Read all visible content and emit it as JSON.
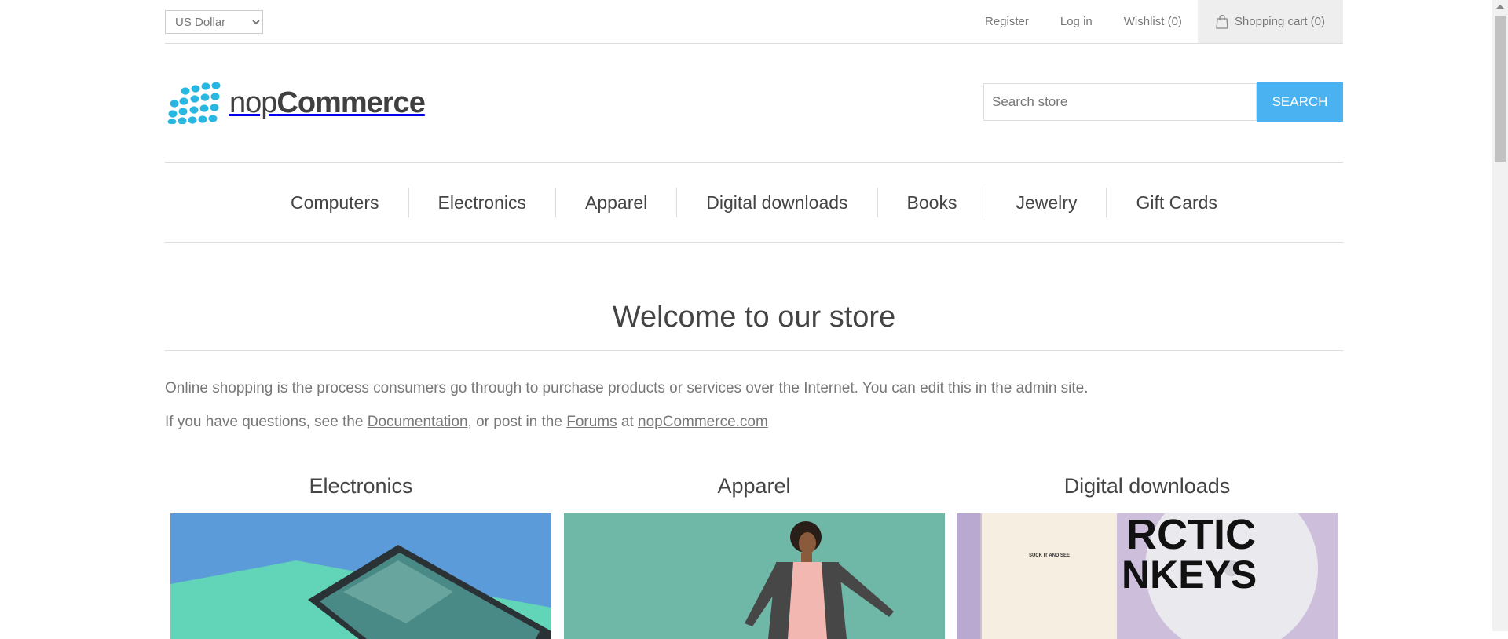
{
  "header": {
    "currency": "US Dollar",
    "links": {
      "register": "Register",
      "login": "Log in",
      "wishlist": "Wishlist (0)",
      "cart": "Shopping cart (0)"
    }
  },
  "logo": {
    "light": "nop",
    "bold": "Commerce"
  },
  "search": {
    "placeholder": "Search store",
    "button": "SEARCH"
  },
  "menu": [
    "Computers",
    "Electronics",
    "Apparel",
    "Digital downloads",
    "Books",
    "Jewelry",
    "Gift Cards"
  ],
  "main": {
    "title": "Welcome to our store",
    "paragraph1": "Online shopping is the process consumers go through to purchase products or services over the Internet. You can edit this in the admin site.",
    "p2_prefix": "If you have questions, see the ",
    "p2_doc": "Documentation",
    "p2_mid": ", or post in the ",
    "p2_forums": "Forums",
    "p2_at": " at ",
    "p2_site": "nopCommerce.com"
  },
  "categories": [
    {
      "title": "Electronics"
    },
    {
      "title": "Apparel"
    },
    {
      "title": "Digital downloads"
    }
  ],
  "album": {
    "text1": "SUCK IT AND SEE",
    "text2": "RCTIC",
    "text3": "NKEYS"
  },
  "colors": {
    "accent": "#4ab2f1",
    "logo": "#29b6e0"
  }
}
